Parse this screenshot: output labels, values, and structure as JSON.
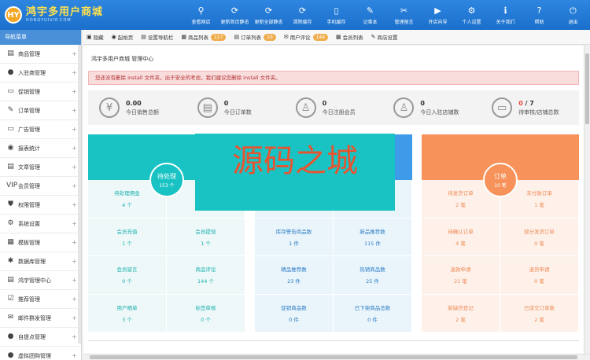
{
  "header": {
    "logo_badge": "HY",
    "logo_title": "鸿宇多用户商城",
    "logo_sub": "HONGYUIVIP.COM",
    "nav": [
      {
        "label": "查看网店",
        "icon": "search-icon",
        "glyph": "⚲"
      },
      {
        "label": "更新首页静态",
        "icon": "refresh-icon",
        "glyph": "⟳"
      },
      {
        "label": "更新全部静态",
        "icon": "refresh-icon",
        "glyph": "⟳"
      },
      {
        "label": "清除缓存",
        "icon": "refresh-icon",
        "glyph": "⟳"
      },
      {
        "label": "手机缓存",
        "icon": "phone-icon",
        "glyph": "▯"
      },
      {
        "label": "记事本",
        "icon": "notepad-icon",
        "glyph": "✎"
      },
      {
        "label": "管理留言",
        "icon": "wrench-icon",
        "glyph": "✂"
      },
      {
        "label": "开店向导",
        "icon": "play-icon",
        "glyph": "▶"
      },
      {
        "label": "个人设置",
        "icon": "gear-icon",
        "glyph": "⚙"
      },
      {
        "label": "关于我们",
        "icon": "info-icon",
        "glyph": "ℹ"
      },
      {
        "label": "帮助",
        "icon": "help-icon",
        "glyph": "?"
      },
      {
        "label": "退出",
        "icon": "power-icon",
        "glyph": "⏻"
      }
    ]
  },
  "sidebar": {
    "title": "导航菜单",
    "items": [
      {
        "label": "商品管理",
        "glyph": "▤"
      },
      {
        "label": "入驻商管理",
        "glyph": "●"
      },
      {
        "label": "促销管理",
        "glyph": "▭"
      },
      {
        "label": "订单管理",
        "glyph": "✎"
      },
      {
        "label": "广告管理",
        "glyph": "▭"
      },
      {
        "label": "报表统计",
        "glyph": "◉"
      },
      {
        "label": "文章管理",
        "glyph": "▤"
      },
      {
        "label": "会员管理",
        "glyph": "VIP"
      },
      {
        "label": "权限管理",
        "glyph": "⛊"
      },
      {
        "label": "系统设置",
        "glyph": "⚙"
      },
      {
        "label": "模板管理",
        "glyph": "▦"
      },
      {
        "label": "数据库管理",
        "glyph": "✱"
      },
      {
        "label": "鸿宇管理中心",
        "glyph": "▤"
      },
      {
        "label": "推荐管理",
        "glyph": "☑"
      },
      {
        "label": "邮件群发管理",
        "glyph": "✉"
      },
      {
        "label": "自提点管理",
        "glyph": "●"
      },
      {
        "label": "虚拟团购管理",
        "glyph": "●"
      }
    ]
  },
  "tabs": [
    {
      "label": "隐藏",
      "glyph": "▣",
      "badge": ""
    },
    {
      "label": "起始页",
      "glyph": "◉",
      "badge": ""
    },
    {
      "label": "设置导航栏",
      "glyph": "▤",
      "badge": ""
    },
    {
      "label": "商品列表",
      "glyph": "▦",
      "badge": "117"
    },
    {
      "label": "订单列表",
      "glyph": "▤",
      "badge": "10"
    },
    {
      "label": "用户评论",
      "glyph": "✉",
      "badge": "144"
    },
    {
      "label": "会员列表",
      "glyph": "▦",
      "badge": ""
    },
    {
      "label": "商店设置",
      "glyph": "✎",
      "badge": ""
    }
  ],
  "main": {
    "crumb": "鸿宇多用户商城 管理中心",
    "alert": "您还没有删除 install 文件夹，出于安全的考虑，我们建议您删除 install 文件夹。",
    "stats": [
      {
        "value": "0.00",
        "label": "今日销售总额",
        "glyph": "¥",
        "icon": "yen-icon"
      },
      {
        "value": "0",
        "label": "今日订单数",
        "glyph": "▤",
        "icon": "clipboard-icon"
      },
      {
        "value": "0",
        "label": "今日注册会员",
        "glyph": "♙",
        "icon": "user-icon"
      },
      {
        "value": "0",
        "label": "今日入驻店铺数",
        "glyph": "♙",
        "icon": "users-icon"
      },
      {
        "value_red": "0",
        "value_rest": " / 7",
        "label": "待审核/店铺总数",
        "glyph": "▭",
        "icon": "shop-icon"
      }
    ],
    "panels": {
      "pending": {
        "title": "待处理",
        "sub": "153 个",
        "cells": [
          {
            "label": "待处理佣金",
            "value": "4 个"
          },
          {
            "label": "",
            "value": ""
          },
          {
            "label": "会员充值",
            "value": "1 个"
          },
          {
            "label": "会员提现",
            "value": "1 个"
          },
          {
            "label": "会员留言",
            "value": "0 个"
          },
          {
            "label": "商品评论",
            "value": "144 个"
          },
          {
            "label": "用户晒单",
            "value": "3 个"
          },
          {
            "label": "标签审核",
            "value": "0 个"
          }
        ]
      },
      "goods": {
        "cells": [
          {
            "label": "",
            "value": ""
          },
          {
            "label": "",
            "value": ""
          },
          {
            "label": "库存警告商品数",
            "value": "1 件"
          },
          {
            "label": "新品推荐数",
            "value": "115 件"
          },
          {
            "label": "精品推荐数",
            "value": "23 件"
          },
          {
            "label": "热销商品数",
            "value": "25 件"
          },
          {
            "label": "促销商品数",
            "value": "0 件"
          },
          {
            "label": "已下架商品总数",
            "value": "0 件"
          }
        ]
      },
      "orders": {
        "title": "订单",
        "sub": "10 笔",
        "cells": [
          {
            "label": "待发货订单",
            "value": "2 笔"
          },
          {
            "label": "未付款订单",
            "value": "1 笔"
          },
          {
            "label": "待确认订单",
            "value": "4 笔"
          },
          {
            "label": "部分发货订单",
            "value": "0 笔"
          },
          {
            "label": "退款申请",
            "value": "21 笔"
          },
          {
            "label": "退货申请",
            "value": "0 笔"
          },
          {
            "label": "新缺货登记",
            "value": "2 笔"
          },
          {
            "label": "已成交订单数",
            "value": "2 笔"
          }
        ]
      }
    },
    "watermark": "源码之城"
  }
}
